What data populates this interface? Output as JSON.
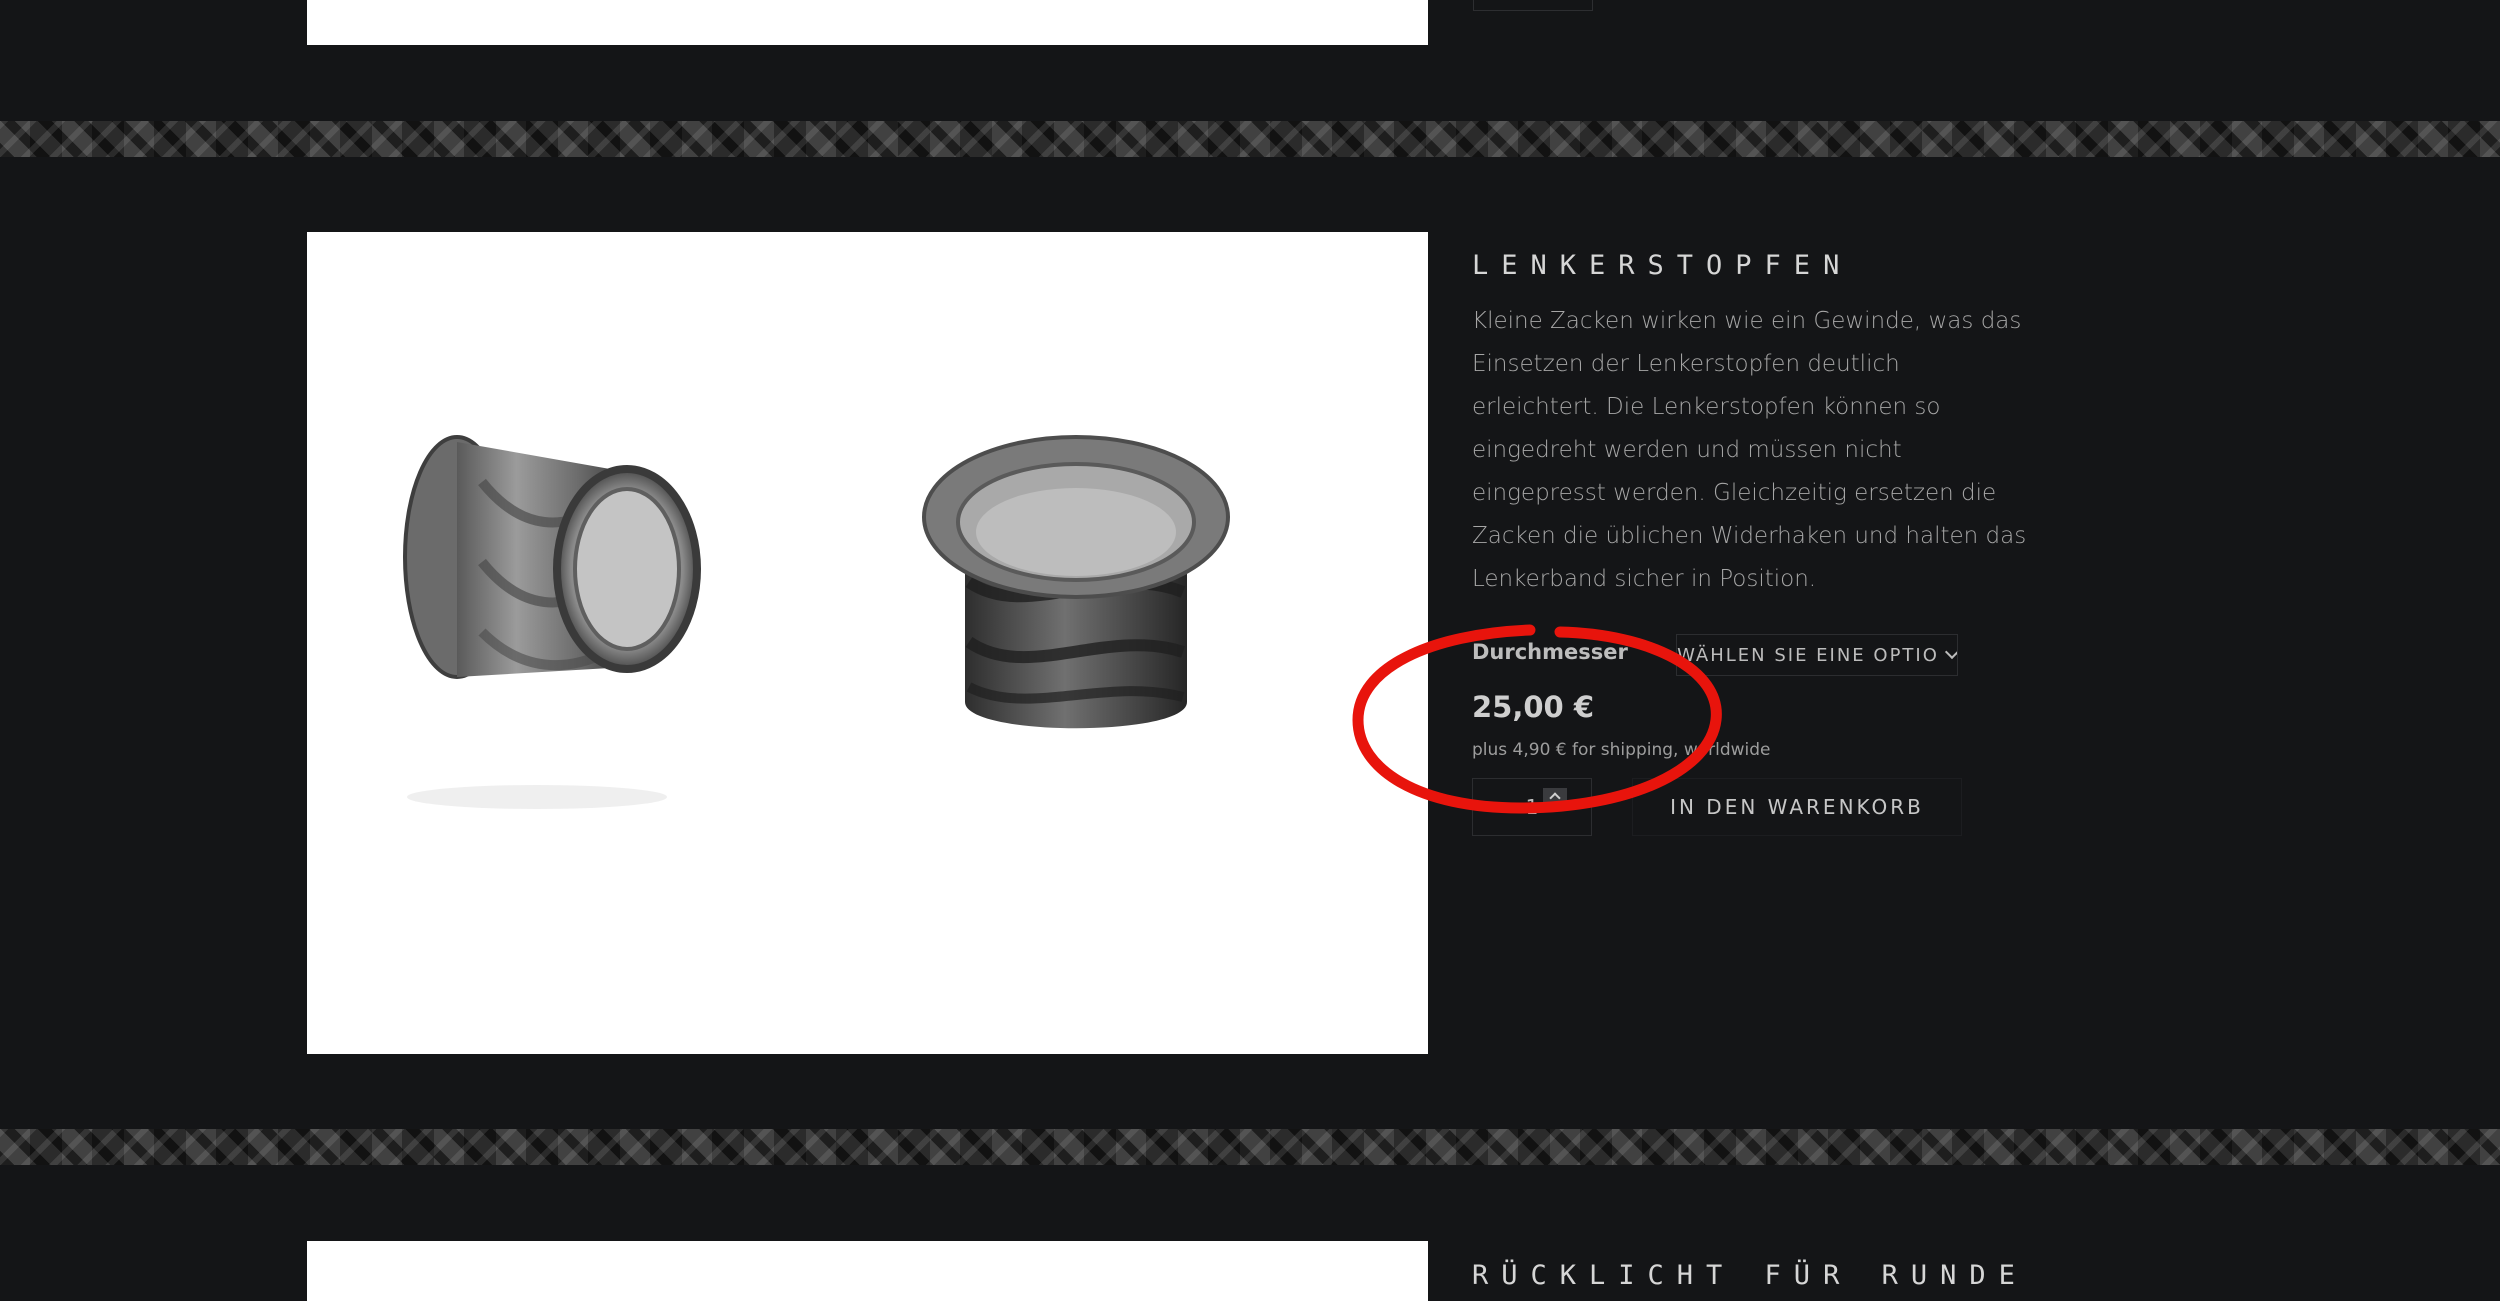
{
  "previous_product": {
    "image_alt": "Vorheriges Produkt"
  },
  "product": {
    "title": "LENKERSTOPFEN",
    "description": "Kleine Zacken wirken wie ein Gewinde, was das Einsetzen der Lenkerstopfen deutlich erleichtert. Die Lenkerstopfen können so eingedreht werden und müssen nicht eingepresst werden. Gleichzeitig ersetzen die Zacken die üblichen Widerhaken und halten das Lenkerband sicher in Position.",
    "variation_label": "Durchmesser",
    "variation_placeholder": "WÄHLEN SIE EINE OPTIO",
    "price": "25,00 €",
    "shipping_note": "plus 4,90 € for shipping, worldwide",
    "quantity": "1",
    "add_to_cart_label": "IN DEN WARENKORB"
  },
  "next_product": {
    "title": "RÜCKLICHT FÜR RUNDE"
  },
  "colors": {
    "background": "#141517",
    "annotation": "#e8140c",
    "image_panel": "#ffffff"
  },
  "icons": {
    "select_chevron": "chevron-down-icon",
    "stepper_up": "chevron-up-icon",
    "stepper_down": "chevron-down-icon"
  }
}
